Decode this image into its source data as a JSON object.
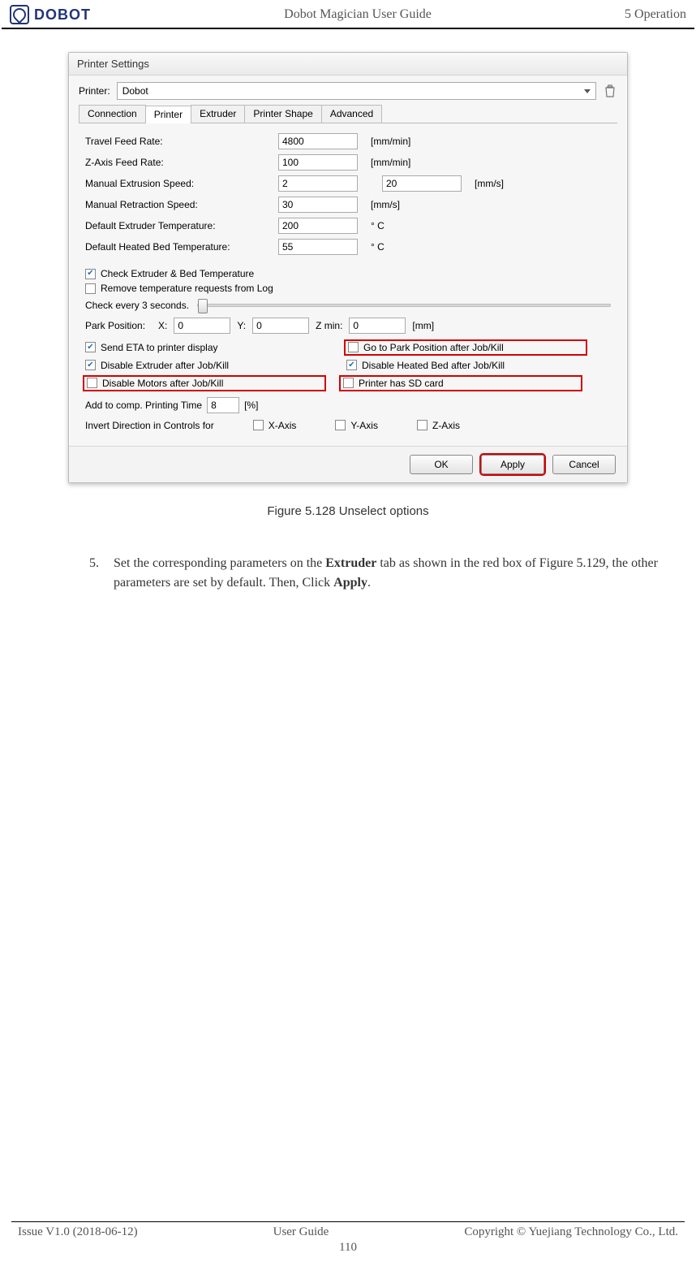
{
  "header": {
    "logo_text": "DOBOT",
    "center": "Dobot Magician User Guide",
    "right": "5 Operation"
  },
  "dialog": {
    "title": "Printer Settings",
    "printer_label": "Printer:",
    "printer_value": "Dobot",
    "tabs": {
      "connection": "Connection",
      "printer": "Printer",
      "extruder": "Extruder",
      "shape": "Printer Shape",
      "advanced": "Advanced"
    },
    "rows": {
      "travel_feed": {
        "label": "Travel Feed Rate:",
        "value": "4800",
        "unit": "[mm/min]"
      },
      "z_feed": {
        "label": "Z-Axis Feed Rate:",
        "value": "100",
        "unit": "[mm/min]"
      },
      "man_ext": {
        "label": "Manual Extrusion Speed:",
        "value": "2",
        "value2": "20",
        "unit": "[mm/s]"
      },
      "man_ret": {
        "label": "Manual Retraction Speed:",
        "value": "30",
        "unit": "[mm/s]"
      },
      "def_ext_temp": {
        "label": "Default Extruder Temperature:",
        "value": "200",
        "unit": "° C"
      },
      "def_bed_temp": {
        "label": "Default Heated Bed Temperature:",
        "value": "55",
        "unit": "° C"
      }
    },
    "checks": {
      "check_temp": "Check Extruder & Bed Temperature",
      "remove_temp_log": "Remove temperature requests from Log",
      "check_every": "Check every 3 seconds.",
      "send_eta": "Send ETA to printer display",
      "goto_park": "Go to Park Position after Job/Kill",
      "disable_ext": "Disable Extruder after Job/Kill",
      "disable_bed": "Disable Heated Bed after Job/Kill",
      "disable_motors": "Disable Motors after Job/Kill",
      "has_sd": "Printer has SD card"
    },
    "park": {
      "label": "Park Position:",
      "x": "X:",
      "xv": "0",
      "y": "Y:",
      "yv": "0",
      "zmin": "Z min:",
      "zv": "0",
      "unit": "[mm]"
    },
    "add_comp": {
      "label": "Add to comp. Printing Time",
      "value": "8",
      "unit": "[%]"
    },
    "invert": {
      "label": "Invert Direction in Controls for",
      "x": "X-Axis",
      "y": "Y-Axis",
      "z": "Z-Axis"
    },
    "buttons": {
      "ok": "OK",
      "apply": "Apply",
      "cancel": "Cancel"
    }
  },
  "figure_caption": "Figure 5.128    Unselect options",
  "body": {
    "num": "5.",
    "text_before_extruder": "Set the corresponding parameters on the ",
    "extruder": "Extruder",
    "text_mid": " tab as shown in the red box of Figure 5.129, the other parameters are set by default. Then, Click ",
    "apply": "Apply",
    "text_end": "."
  },
  "footer": {
    "left": "Issue V1.0 (2018-06-12)",
    "center": "User Guide",
    "right": "Copyright © Yuejiang Technology Co., Ltd.",
    "page": "110"
  }
}
